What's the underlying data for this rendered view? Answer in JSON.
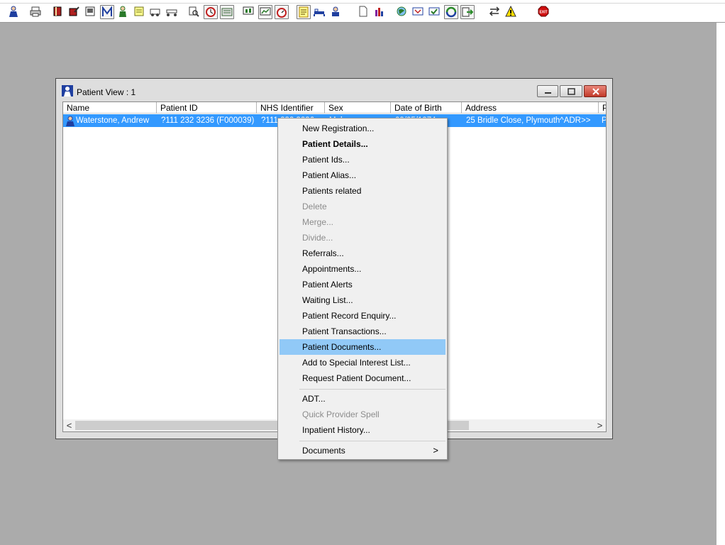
{
  "toolbar": {
    "buttons": [
      {
        "name": "patient-search-icon",
        "color": "#1f3fa0"
      },
      {
        "name": "printer-icon",
        "color": "#404040"
      },
      {
        "name": "book-icon",
        "color": "#b02020"
      },
      {
        "name": "book-edit-icon",
        "color": "#b02020"
      },
      {
        "name": "document-scan-icon",
        "color": "#303030"
      },
      {
        "name": "letter-m-icon",
        "color": "#2040a0"
      },
      {
        "name": "clinician-icon",
        "color": "#2a7a2a"
      },
      {
        "name": "notepad-icon",
        "color": "#707020"
      },
      {
        "name": "ambulance-icon",
        "color": "#404040"
      },
      {
        "name": "stretcher-icon",
        "color": "#404040"
      },
      {
        "name": "search-document-icon",
        "color": "#404040"
      },
      {
        "name": "clock-icon",
        "color": "#c02020"
      },
      {
        "name": "screen-icon",
        "color": "#3a6a3a"
      },
      {
        "name": "monitor-chart-icon",
        "color": "#2a7a2a"
      },
      {
        "name": "monitor-graph-icon",
        "color": "#2a7a2a"
      },
      {
        "name": "stopwatch-icon",
        "color": "#c02020"
      },
      {
        "name": "notes-icon",
        "color": "#b08000"
      },
      {
        "name": "bed-icon",
        "color": "#2040a0"
      },
      {
        "name": "nurse-icon",
        "color": "#2040a0"
      },
      {
        "name": "blank-document-icon",
        "color": "#505050"
      },
      {
        "name": "bar-chart-icon",
        "color": "#8020a0"
      },
      {
        "name": "globe-icon",
        "color": "#2a7a2a"
      },
      {
        "name": "inbox-icon",
        "color": "#2040a0"
      },
      {
        "name": "inbox-check-icon",
        "color": "#2040a0"
      },
      {
        "name": "recycle-icon",
        "color": "#2a8a2a"
      },
      {
        "name": "transfer-icon",
        "color": "#2a8a2a"
      },
      {
        "name": "swap-icon",
        "color": "#303030"
      },
      {
        "name": "warning-icon",
        "color": "#e0c000"
      },
      {
        "name": "exit-icon",
        "color": "#d01010"
      }
    ],
    "exit_label": "EXIT"
  },
  "window": {
    "title": "Patient View : 1",
    "columns": [
      "Name",
      "Patient ID",
      "NHS Identifier",
      "Sex",
      "Date of Birth",
      "Address",
      "P"
    ],
    "selected_row": {
      "name": "Waterstone, Andrew",
      "patient_id": "?111 232 3236 (F000039)",
      "nhs_identifier": "?111 232 3236",
      "sex": "Male",
      "date_of_birth": "09/05/1974",
      "address": "25 Bridle Close, Plymouth^ADR>>",
      "p": "P"
    },
    "scroll_left": "<",
    "scroll_right": ">"
  },
  "context_menu": {
    "items": [
      {
        "label": "New Registration...",
        "state": "normal"
      },
      {
        "label": "Patient Details...",
        "state": "bold"
      },
      {
        "label": "Patient Ids...",
        "state": "normal"
      },
      {
        "label": "Patient Alias...",
        "state": "normal"
      },
      {
        "label": "Patients related",
        "state": "normal"
      },
      {
        "label": "Delete",
        "state": "disabled"
      },
      {
        "label": "Merge...",
        "state": "disabled"
      },
      {
        "label": "Divide...",
        "state": "disabled"
      },
      {
        "label": "Referrals...",
        "state": "normal"
      },
      {
        "label": "Appointments...",
        "state": "normal"
      },
      {
        "label": "Patient Alerts",
        "state": "normal"
      },
      {
        "label": "Waiting List...",
        "state": "normal"
      },
      {
        "label": "Patient Record Enquiry...",
        "state": "normal"
      },
      {
        "label": "Patient Transactions...",
        "state": "normal"
      },
      {
        "label": "Patient Documents...",
        "state": "highlighted"
      },
      {
        "label": "Add to Special Interest List...",
        "state": "normal"
      },
      {
        "label": "Request Patient Document...",
        "state": "normal"
      },
      {
        "label": "ADT...",
        "state": "normal"
      },
      {
        "label": "Quick Provider Spell",
        "state": "disabled"
      },
      {
        "label": "Inpatient History...",
        "state": "normal"
      },
      {
        "label": "Documents",
        "state": "submenu"
      }
    ],
    "submenu_arrow": ">"
  },
  "colors": {
    "desktop": "#ababab",
    "selection": "#3399ff",
    "menu_highlight": "#91c9f7"
  }
}
